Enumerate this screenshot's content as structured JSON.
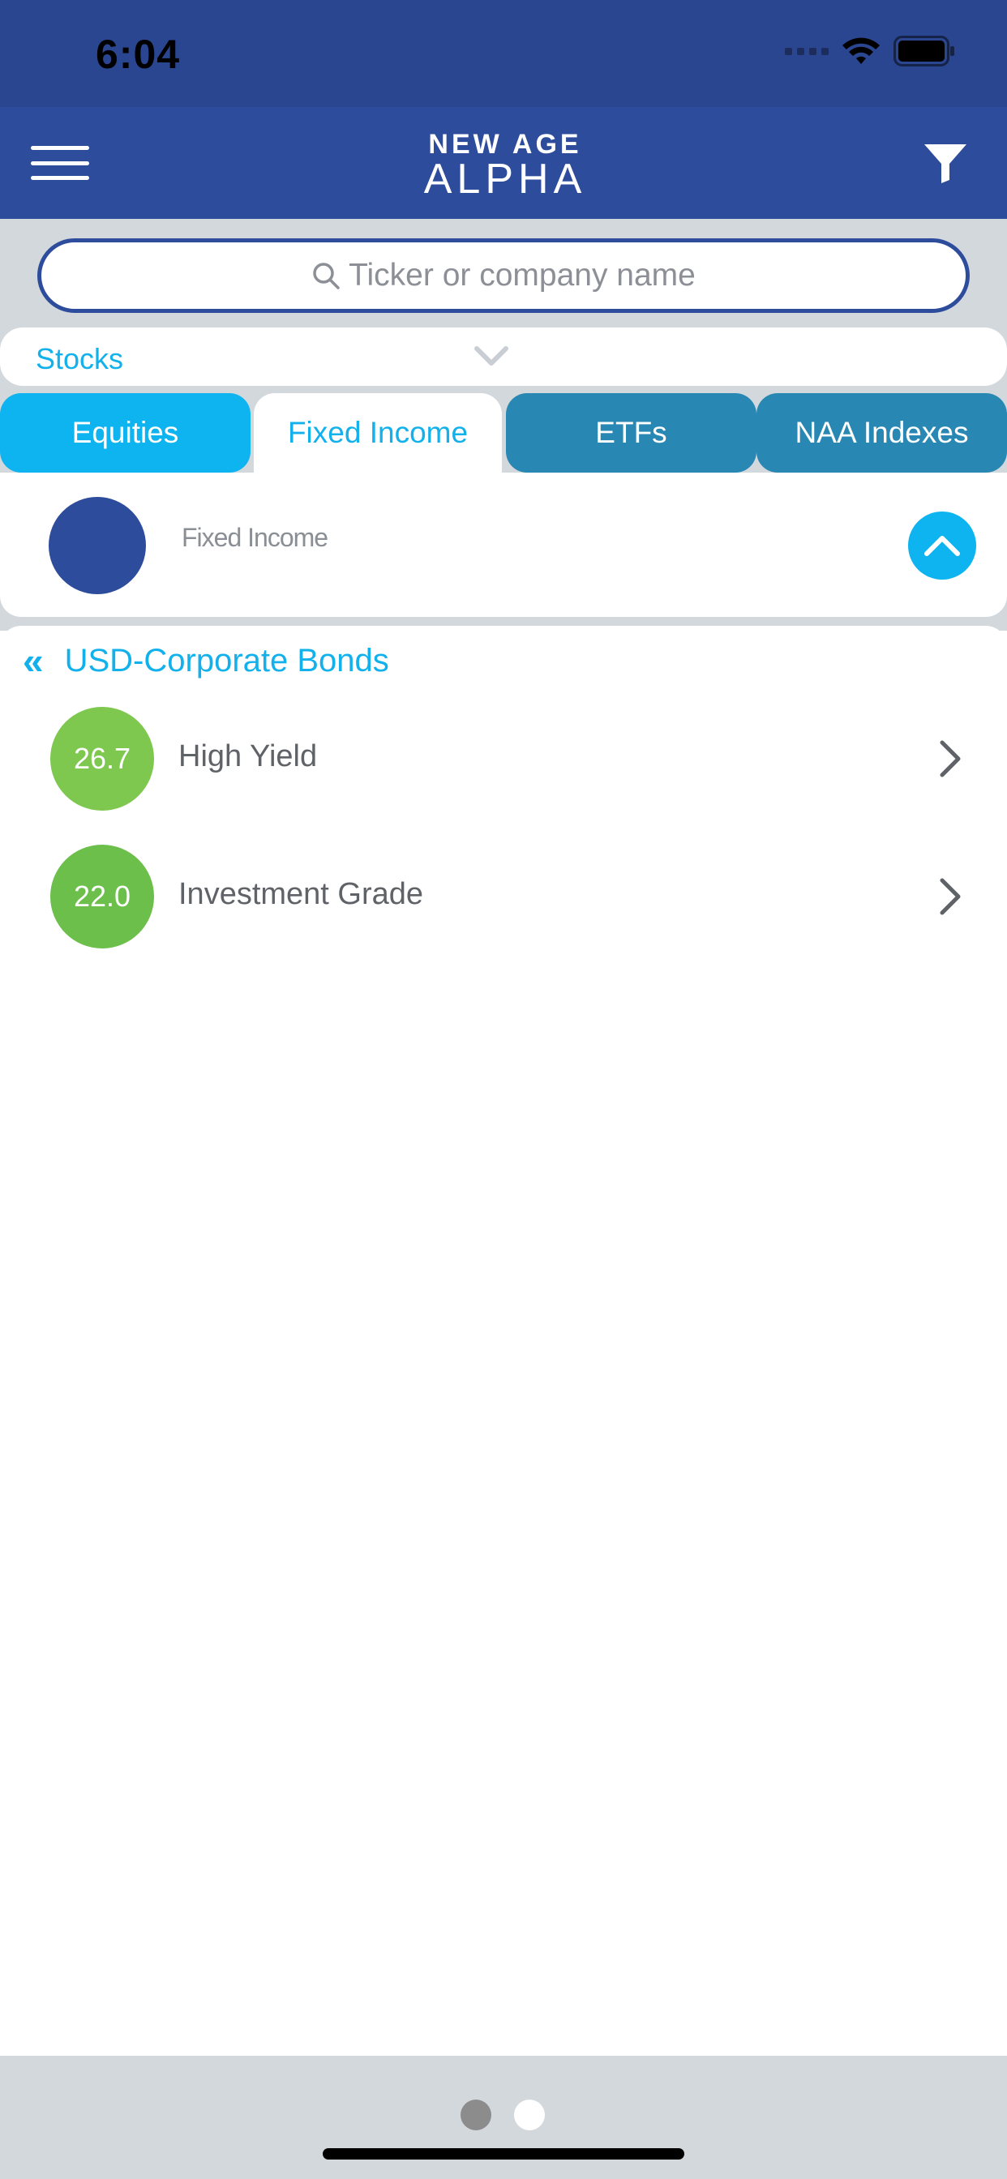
{
  "status_bar": {
    "time": "6:04"
  },
  "app": {
    "logo_line1": "NEW AGE",
    "logo_line2": "ALPHA",
    "colors": {
      "nav": "#2e4c9c",
      "accent": "#0db4f0",
      "tab_inactive": "#2888b3",
      "score_green": "#7ec84f"
    }
  },
  "search": {
    "placeholder": "Ticker or company name"
  },
  "dropdown": {
    "selected": "Stocks"
  },
  "tabs": [
    {
      "label": "Equities",
      "active": false
    },
    {
      "label": "Fixed Income",
      "active": true
    },
    {
      "label": "ETFs",
      "active": false
    },
    {
      "label": "NAA Indexes",
      "active": false
    }
  ],
  "section": {
    "label": "Fixed Income"
  },
  "breadcrumb": {
    "title": "USD-Corporate Bonds"
  },
  "items": [
    {
      "score": "26.7",
      "label": "High Yield",
      "color": "#7ec84f"
    },
    {
      "score": "22.0",
      "label": "Investment Grade",
      "color": "#6cbf4a"
    }
  ],
  "pager": {
    "pages": 2,
    "current": 1
  }
}
